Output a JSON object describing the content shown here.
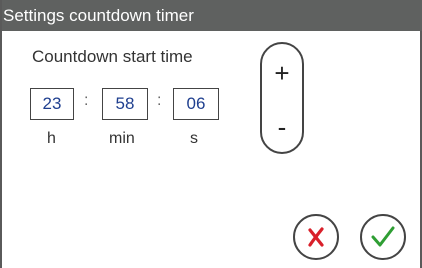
{
  "window": {
    "title": "Settings countdown timer"
  },
  "countdown": {
    "label": "Countdown start time",
    "hours": "23",
    "minutes": "58",
    "seconds": "06",
    "separator": ":",
    "units": {
      "hours": "h",
      "minutes": "min",
      "seconds": "s"
    }
  },
  "stepper": {
    "increment": "+",
    "decrement": "-"
  },
  "actions": {
    "cancel_icon": "x-icon",
    "confirm_icon": "check-icon",
    "cancel_color": "#d9202a",
    "confirm_color": "#2f9e34"
  }
}
